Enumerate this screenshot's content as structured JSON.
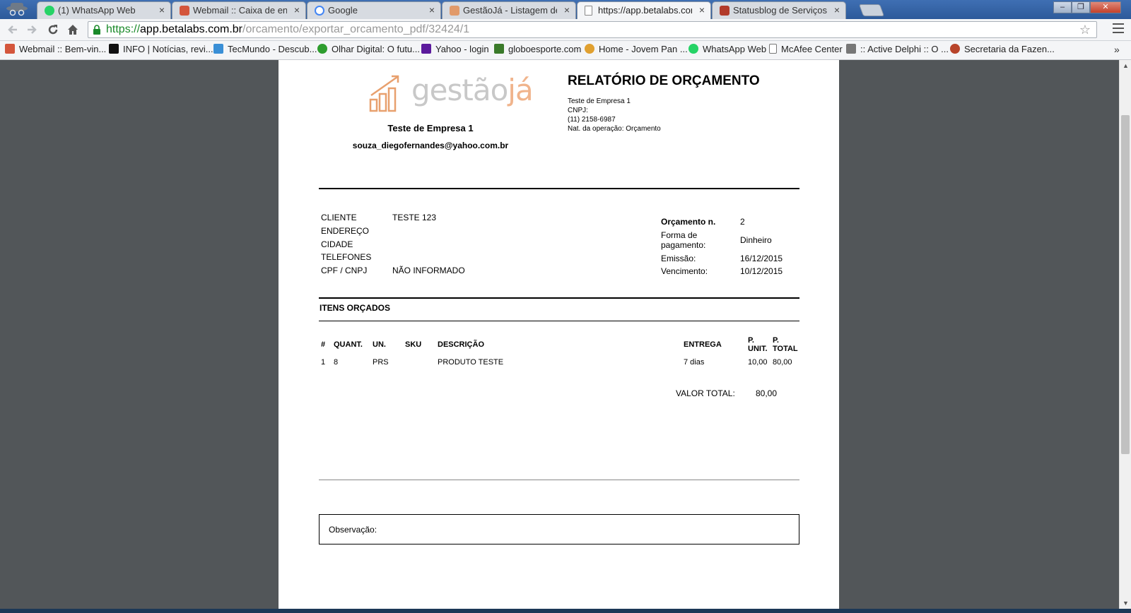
{
  "browser": {
    "tabs": [
      {
        "title": "(1) WhatsApp Web",
        "favicon": "whatsapp-icon",
        "color": "#25d366",
        "active": false
      },
      {
        "title": "Webmail :: Caixa de entrada",
        "favicon": "webmail-icon",
        "color": "#d4563c",
        "active": false
      },
      {
        "title": "Google",
        "favicon": "google-icon",
        "color": "#4285f4",
        "active": false
      },
      {
        "title": "GestãoJá - Listagem de orçamentos",
        "favicon": "gestaoja-icon",
        "color": "#e19a6a",
        "active": false
      },
      {
        "title": "https://app.betalabs.com.br/orcamento",
        "favicon": "page-icon",
        "color": "#ffffff",
        "active": true
      },
      {
        "title": "Statusblog de Serviços da",
        "favicon": "statusblog-icon",
        "color": "#b23a2a",
        "active": false
      }
    ],
    "tab_close_glyph": "×",
    "window_controls": {
      "minimize": "–",
      "maximize": "❐",
      "close": "✕"
    },
    "url": {
      "scheme": "https://",
      "host": "app.betalabs.com.br",
      "path": "/orcamento/exportar_orcamento_pdf/32424/1"
    },
    "bookmarks": [
      {
        "label": "Webmail :: Bem-vin...",
        "icon": "webmail-icon",
        "color": "#d4563c"
      },
      {
        "label": "INFO | Notícias, revi...",
        "icon": "info-icon",
        "color": "#111111"
      },
      {
        "label": "TecMundo - Descub...",
        "icon": "tecmundo-icon",
        "color": "#3a8fd6"
      },
      {
        "label": "Olhar Digital: O futu...",
        "icon": "olhardigital-icon",
        "color": "#2e9d2e"
      },
      {
        "label": "Yahoo - login",
        "icon": "yahoo-icon",
        "color": "#5b1a9c"
      },
      {
        "label": "globoesporte.com",
        "icon": "ge-icon",
        "color": "#3a7a2a"
      },
      {
        "label": "Home - Jovem Pan ...",
        "icon": "jovempan-icon",
        "color": "#e0a030"
      },
      {
        "label": "WhatsApp Web",
        "icon": "whatsapp-icon",
        "color": "#25d366"
      },
      {
        "label": "McAfee Center",
        "icon": "document-icon",
        "color": "#dddddd"
      },
      {
        "label": ":: Active Delphi :: O ...",
        "icon": "building-icon",
        "color": "#777777"
      },
      {
        "label": "Secretaria da Fazen...",
        "icon": "seal-icon",
        "color": "#b8442a"
      }
    ],
    "bookmarks_more": "»"
  },
  "document": {
    "logo": {
      "text_gray": "gestão",
      "text_orange": "já"
    },
    "company": {
      "name": "Teste de Empresa 1",
      "email": "souza_diegofernandes@yahoo.com.br"
    },
    "title": "RELATÓRIO DE ORÇAMENTO",
    "header_lines": [
      "Teste de Empresa 1",
      "CNPJ:",
      "(11) 2158-6987",
      "Nat. da operação: Orçamento"
    ],
    "client": {
      "labels": [
        "CLIENTE",
        "ENDEREÇO",
        "CIDADE",
        "TELEFONES",
        "CPF / CNPJ"
      ],
      "values": [
        "TESTE 123",
        "",
        "",
        "",
        "NÃO INFORMADO"
      ]
    },
    "budget": {
      "number_label": "Orçamento n.",
      "number": "2",
      "payment_label_1": "Forma de",
      "payment_label_2": "pagamento:",
      "payment": "Dinheiro",
      "issue_label": "Emissão:",
      "issue": "16/12/2015",
      "due_label": "Vencimento:",
      "due": "10/12/2015"
    },
    "items_title": "ITENS ORÇADOS",
    "columns": {
      "num": "#",
      "qty": "QUANT.",
      "unit": "UN.",
      "sku": "SKU",
      "desc": "DESCRIÇÃO",
      "delivery": "ENTREGA",
      "unit_price_1": "P.",
      "unit_price_2": "UNIT.",
      "total_price_1": "P.",
      "total_price_2": "TOTAL"
    },
    "items": [
      {
        "num": "1",
        "qty": "8",
        "unit": "PRS",
        "sku": "",
        "desc": "PRODUTO TESTE",
        "delivery": "7 dias",
        "unit_price": "10,00",
        "total": "80,00"
      }
    ],
    "total_label": "VALOR TOTAL:",
    "total_value": "80,00",
    "observation_label": "Observação:"
  }
}
